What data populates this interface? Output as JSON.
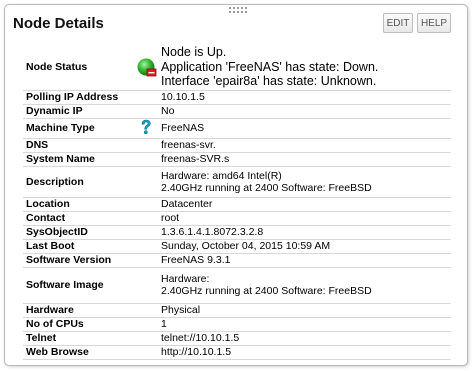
{
  "panel": {
    "title": "Node Details",
    "edit_label": "EDIT",
    "help_label": "HELP"
  },
  "details": {
    "node_status": {
      "label": "Node Status",
      "icon": "node-up-with-warning-icon",
      "line1": "Node is Up.",
      "line2": "Application 'FreeNAS' has state: Down.",
      "line3": "Interface 'epair8a' has state: Unknown."
    },
    "polling_ip": {
      "label": "Polling IP Address",
      "value": "10.10.1.5"
    },
    "dynamic_ip": {
      "label": "Dynamic IP",
      "value": "No"
    },
    "machine_type": {
      "label": "Machine Type",
      "icon": "question-mark-icon",
      "value": "FreeNAS"
    },
    "dns": {
      "label": "DNS",
      "value": "freenas-svr."
    },
    "system_name": {
      "label": "System Name",
      "value": "freenas-SVR.s"
    },
    "description": {
      "label": "Description",
      "line1": "Hardware: amd64 Intel(R)",
      "line2": "2.40GHz running at 2400 Software: FreeBSD"
    },
    "location": {
      "label": "Location",
      "value": "Datacenter"
    },
    "contact": {
      "label": "Contact",
      "value": "root"
    },
    "sysobjectid": {
      "label": "SysObjectID",
      "value": "1.3.6.1.4.1.8072.3.2.8"
    },
    "last_boot": {
      "label": "Last Boot",
      "value": "Sunday, October 04, 2015 10:59 AM"
    },
    "software_version": {
      "label": "Software Version",
      "value": "FreeNAS 9.3.1"
    },
    "software_image": {
      "label": "Software Image",
      "line1": "Hardware:",
      "line2": "2.40GHz running at 2400 Software: FreeBSD"
    },
    "hardware": {
      "label": "Hardware",
      "value": "Physical"
    },
    "no_of_cpus": {
      "label": "No of CPUs",
      "value": "1"
    },
    "telnet": {
      "label": "Telnet",
      "value": "telnet://10.10.1.5"
    },
    "web_browse": {
      "label": "Web Browse",
      "value": "http://10.10.1.5"
    }
  },
  "colors": {
    "status_green": "#2fb52f",
    "status_red": "#d42020",
    "help_teal": "#15a3c4"
  }
}
